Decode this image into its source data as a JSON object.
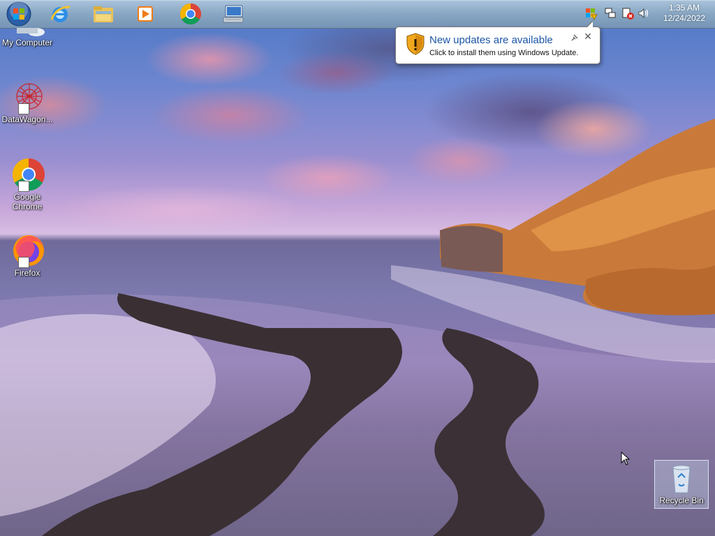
{
  "taskbar": {
    "pinned": [
      {
        "name": "internet-explorer-icon"
      },
      {
        "name": "file-explorer-icon"
      },
      {
        "name": "media-player-icon"
      },
      {
        "name": "chrome-icon"
      },
      {
        "name": "remote-desktop-icon"
      }
    ],
    "tray": {
      "icons": [
        "windows-update-icon",
        "network-icon",
        "action-center-icon",
        "volume-icon"
      ]
    },
    "clock": {
      "time": "1:35 AM",
      "date": "12/24/2022"
    }
  },
  "notification": {
    "title": "New updates are available",
    "message": "Click to install them using Windows Update.",
    "icon": "shield-warning-icon"
  },
  "desktop": {
    "icons": [
      {
        "label": "My Computer"
      },
      {
        "label": "DataWagon..."
      },
      {
        "label": "Google Chrome"
      },
      {
        "label": "Firefox"
      }
    ],
    "recycle_bin": {
      "label": "Recycle Bin"
    }
  },
  "colors": {
    "balloon_title": "#1c56a8",
    "taskbar": "#8caac3"
  }
}
